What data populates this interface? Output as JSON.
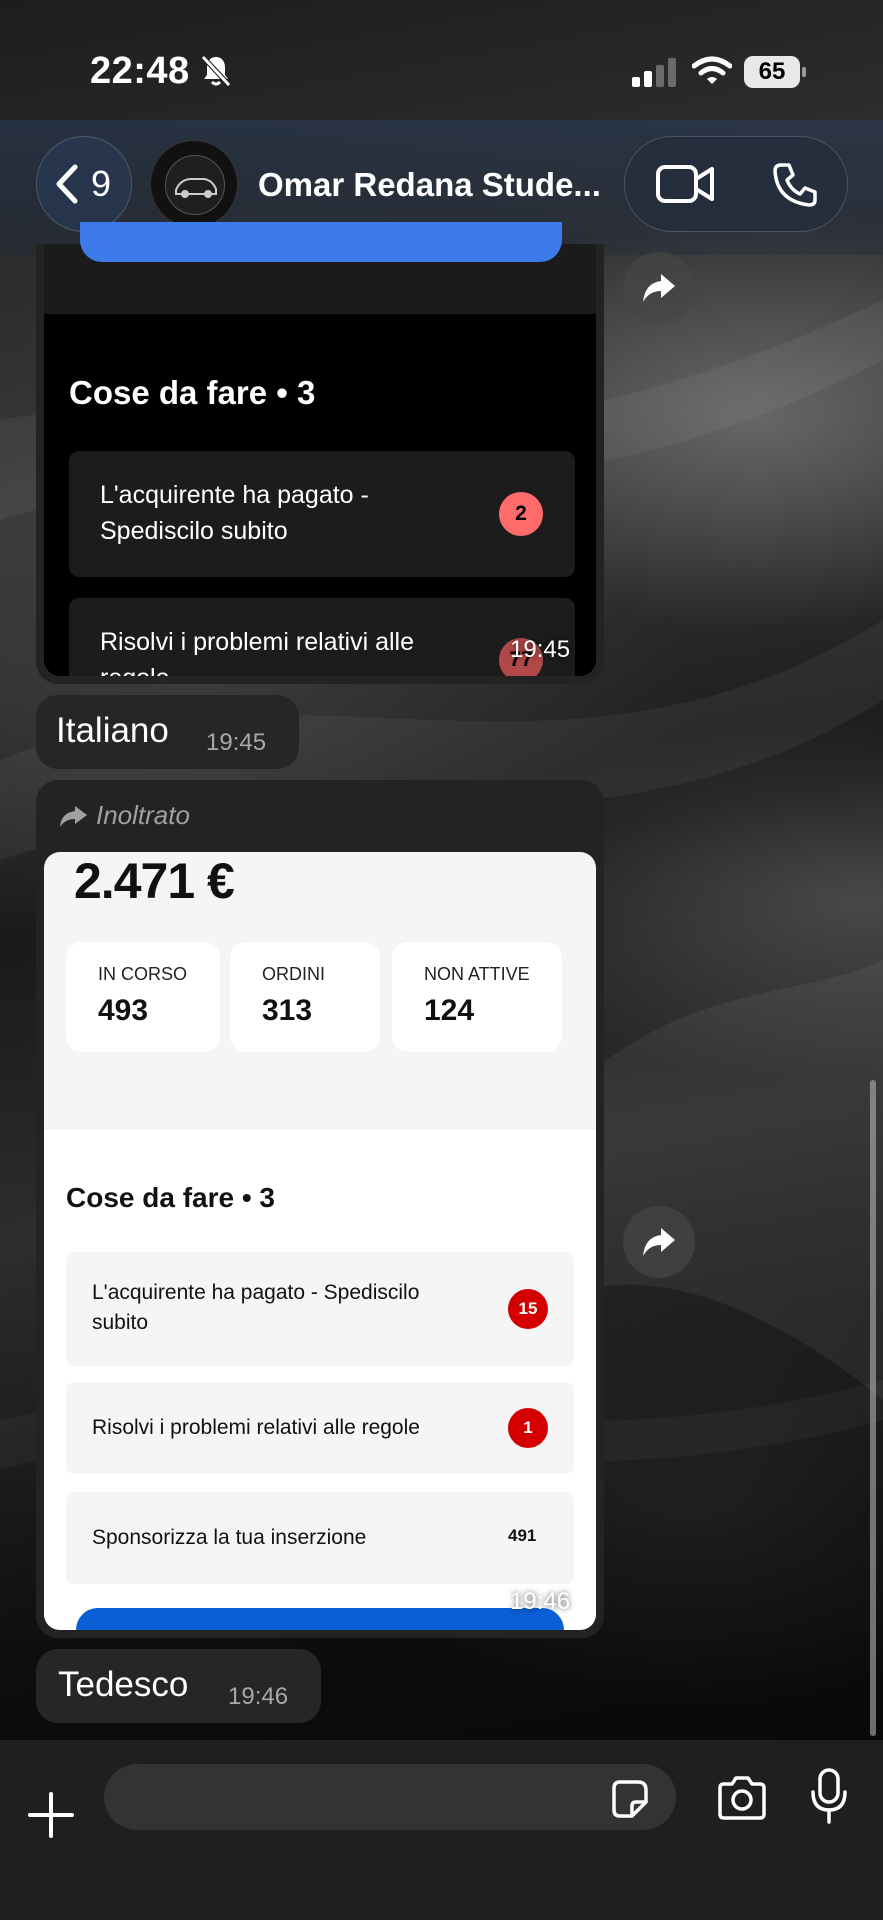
{
  "status_bar": {
    "time": "22:48",
    "battery": "65",
    "icons": [
      "bell-slash-icon",
      "signal-icon",
      "wifi-icon",
      "battery-icon"
    ]
  },
  "header": {
    "back_count": "9",
    "contact_name": "Omar Redana Stude...",
    "icons": [
      "chevron-left-icon",
      "video-call-icon",
      "phone-icon"
    ]
  },
  "messages": {
    "image1": {
      "section_title": "Cose da fare • 3",
      "tasks": [
        {
          "label": "L'acquirente ha pagato - Spediscilo subito",
          "badge": "2"
        },
        {
          "label": "Risolvi i problemi relativi alle regole",
          "badge": "77"
        }
      ],
      "time": "19:45"
    },
    "text1": {
      "text": "Italiano",
      "time": "19:45"
    },
    "forwarded": {
      "label": "Inoltrato",
      "total": "2.471 €",
      "stats": [
        {
          "label": "IN CORSO",
          "value": "493"
        },
        {
          "label": "ORDINI",
          "value": "313"
        },
        {
          "label": "NON ATTIVE",
          "value": "124"
        }
      ],
      "section_title": "Cose da fare • 3",
      "tasks": [
        {
          "label": "L'acquirente ha pagato - Spediscilo subito",
          "badge": "15"
        },
        {
          "label": "Risolvi i problemi relativi alle regole",
          "badge": "1"
        },
        {
          "label": "Sponsorizza la tua inserzione",
          "badge": "491"
        }
      ],
      "time": "19:46"
    },
    "text2": {
      "text": "Tedesco",
      "time": "19:46"
    }
  },
  "input_bar": {
    "placeholder": "",
    "icons": [
      "plus-icon",
      "sticker-icon",
      "camera-icon",
      "microphone-icon"
    ]
  },
  "colors": {
    "header_bg": "#2a3a55",
    "bubble_bg": "#262626",
    "badge_pink": "#ff6b6b",
    "badge_red": "#d40000",
    "accent_blue": "#0a5fd6"
  }
}
